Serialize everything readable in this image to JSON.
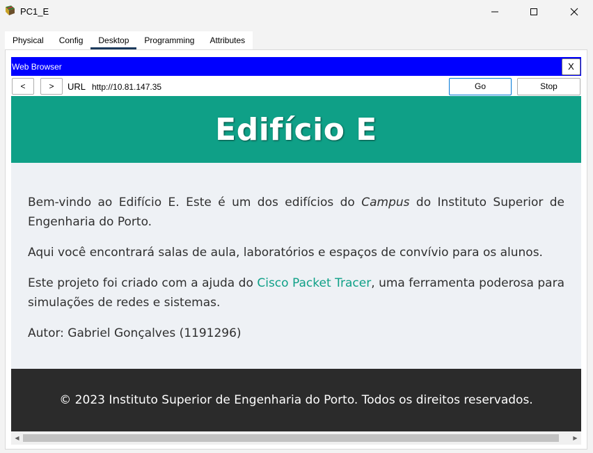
{
  "window": {
    "title": "PC1_E",
    "app_icon": "packet-tracer-pc-icon",
    "controls": [
      "minimize-icon",
      "maximize-icon",
      "close-icon"
    ]
  },
  "tabs": [
    {
      "label": "Physical",
      "active": false
    },
    {
      "label": "Config",
      "active": false
    },
    {
      "label": "Desktop",
      "active": true
    },
    {
      "label": "Programming",
      "active": false
    },
    {
      "label": "Attributes",
      "active": false
    }
  ],
  "web_browser": {
    "title": "Web Browser",
    "close_label": "X",
    "back_label": "<",
    "forward_label": ">",
    "url_label": "URL",
    "url_value": "http://10.81.147.35",
    "go_label": "Go",
    "stop_label": "Stop"
  },
  "page": {
    "title": "Edifício E",
    "paragraphs": {
      "p1_pre": "Bem-vindo ao Edifício E. Este é um dos edifícios do ",
      "p1_em": "Campus",
      "p1_post": " do Instituto Superior de Engenharia do Porto.",
      "p2": "Aqui você encontrará salas de aula, laboratórios e espaços de convívio para os alunos.",
      "p3_pre": "Este projeto foi criado com a ajuda do ",
      "p3_link": "Cisco Packet Tracer",
      "p3_post": ", uma ferramenta poderosa para simulações de redes e sistemas.",
      "p4": "Autor: Gabriel Gonçalves (1191296)"
    },
    "footer": "© 2023 Instituto Superior de Engenharia do Porto. Todos os direitos reservados."
  },
  "scrollbar": {
    "left_arrow": "◀",
    "right_arrow": "▶"
  },
  "colors": {
    "header_bg": "#0fa087",
    "footer_bg": "#2b2b2b",
    "page_bg": "#eef1f5",
    "browser_titlebar": "#0000ff",
    "link": "#0fa087"
  }
}
